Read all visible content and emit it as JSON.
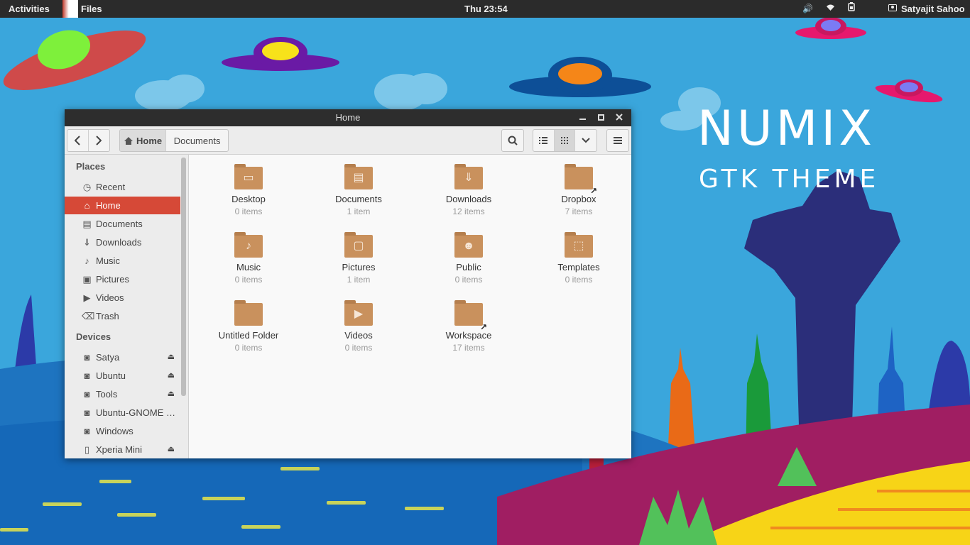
{
  "topbar": {
    "activities": "Activities",
    "app_name": "Files",
    "clock": "Thu 23:54",
    "icons": [
      "volume-icon",
      "wifi-icon",
      "battery-icon"
    ],
    "user": "Satyajit Sahoo"
  },
  "wallpaper": {
    "title": "NUMIX",
    "subtitle": "GTK THEME"
  },
  "window": {
    "title": "Home",
    "controls": [
      "minimize",
      "maximize",
      "close"
    ]
  },
  "toolbar": {
    "back": "back-icon",
    "forward": "forward-icon",
    "breadcrumb": [
      "Home",
      "Documents"
    ],
    "active_crumb": "Home"
  },
  "sidebar": {
    "places_heading": "Places",
    "places": [
      {
        "label": "Recent",
        "icon": "clock-icon"
      },
      {
        "label": "Home",
        "icon": "home-icon",
        "active": true
      },
      {
        "label": "Documents",
        "icon": "document-icon"
      },
      {
        "label": "Downloads",
        "icon": "download-icon"
      },
      {
        "label": "Music",
        "icon": "music-icon"
      },
      {
        "label": "Pictures",
        "icon": "picture-icon"
      },
      {
        "label": "Videos",
        "icon": "video-icon"
      },
      {
        "label": "Trash",
        "icon": "trash-icon"
      }
    ],
    "devices_heading": "Devices",
    "devices": [
      {
        "label": "Satya",
        "eject": true
      },
      {
        "label": "Ubuntu",
        "eject": true
      },
      {
        "label": "Tools",
        "eject": true
      },
      {
        "label": "Ubuntu-GNOME …",
        "eject": false
      },
      {
        "label": "Windows",
        "eject": false
      },
      {
        "label": "Xperia Mini",
        "eject": true
      }
    ]
  },
  "files": [
    {
      "name": "Desktop",
      "count": "0 items"
    },
    {
      "name": "Documents",
      "count": "1 item"
    },
    {
      "name": "Downloads",
      "count": "12 items"
    },
    {
      "name": "Dropbox",
      "count": "7 items"
    },
    {
      "name": "Music",
      "count": "0 items"
    },
    {
      "name": "Pictures",
      "count": "1 item"
    },
    {
      "name": "Public",
      "count": "0 items"
    },
    {
      "name": "Templates",
      "count": "0 items"
    },
    {
      "name": "Untitled Folder",
      "count": "0 items"
    },
    {
      "name": "Videos",
      "count": "0 items"
    },
    {
      "name": "Workspace",
      "count": "17 items"
    }
  ],
  "colors": {
    "accent": "#d64937",
    "folder": "#c9915d",
    "topbar": "#2b2b2b"
  }
}
